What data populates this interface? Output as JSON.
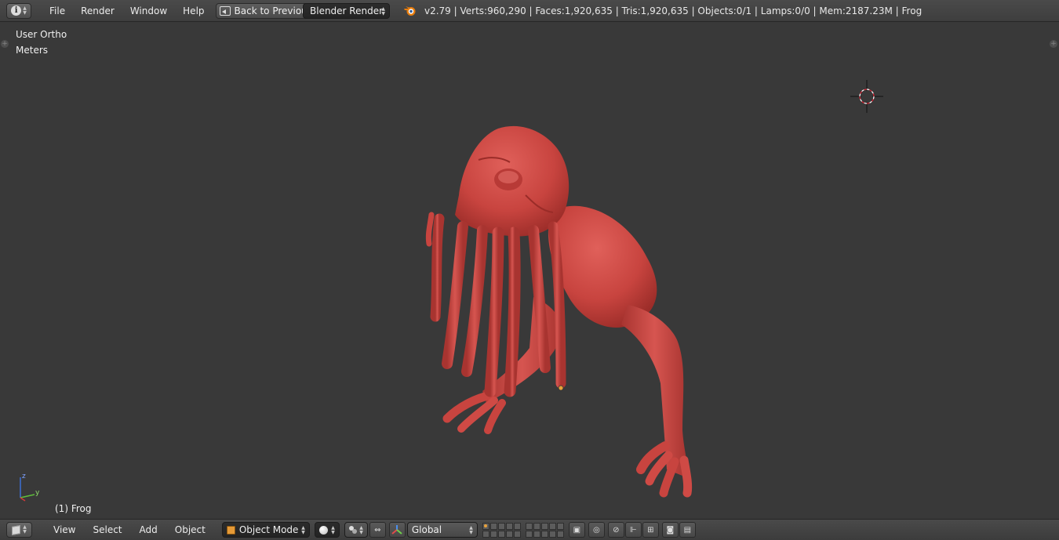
{
  "topbar": {
    "editor_icon": "info-icon",
    "menu": [
      "File",
      "Render",
      "Window",
      "Help"
    ],
    "back_label": "Back to Previous",
    "render_engine": "Blender Render",
    "stats": "v2.79 | Verts:960,290 | Faces:1,920,635 | Tris:1,920,635 | Objects:0/1 | Lamps:0/0 | Mem:2187.23M | Frog"
  },
  "viewport": {
    "view_name": "User Ortho",
    "units": "Meters",
    "object_label": "(1) Frog",
    "axis": {
      "z": "z",
      "y": "y"
    },
    "model_color": "#c8443f",
    "background": "#393939"
  },
  "bottombar": {
    "editor_icon": "3d-view-icon",
    "menu": [
      "View",
      "Select",
      "Add",
      "Object"
    ],
    "mode": "Object Mode",
    "transform_orientation": "Global"
  }
}
